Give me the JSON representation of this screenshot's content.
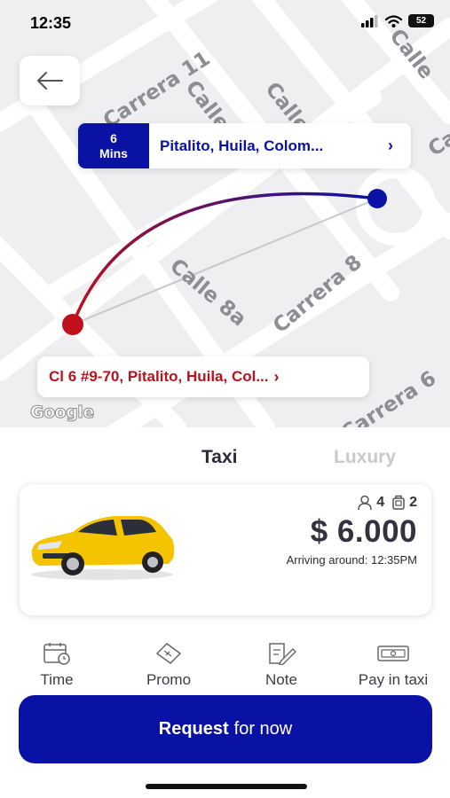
{
  "status_bar": {
    "time": "12:35",
    "battery": "52"
  },
  "map": {
    "streets": [
      "Carrera 11",
      "Calle",
      "Calle",
      "Calle",
      "Calle 8a",
      "Carrera 8",
      "Carrera 6",
      "Ca"
    ],
    "route_colors": {
      "origin": "#c0101c",
      "destination": "#0a12a6"
    },
    "attribution": "Google"
  },
  "route": {
    "eta_value": "6",
    "eta_unit": "Mins",
    "destination": "Pitalito, Huila, Colom...",
    "origin": "Cl 6 #9-70, Pitalito, Huila, Col..."
  },
  "tabs": {
    "active": "Taxi",
    "inactive": "Luxury"
  },
  "ride": {
    "passengers": "4",
    "luggage": "2",
    "price": "$ 6.000",
    "arrival": "Arriving around: 12:35PM"
  },
  "options": [
    {
      "label": "Time",
      "icon": "calendar-clock-icon"
    },
    {
      "label": "Promo",
      "icon": "promo-ticket-icon"
    },
    {
      "label": "Note",
      "icon": "note-pencil-icon"
    },
    {
      "label": "Pay in taxi",
      "icon": "cash-icon"
    }
  ],
  "request": {
    "strong": "Request",
    "rest": "for now"
  },
  "colors": {
    "primary": "#0a12a6",
    "origin_red": "#b7141e"
  }
}
